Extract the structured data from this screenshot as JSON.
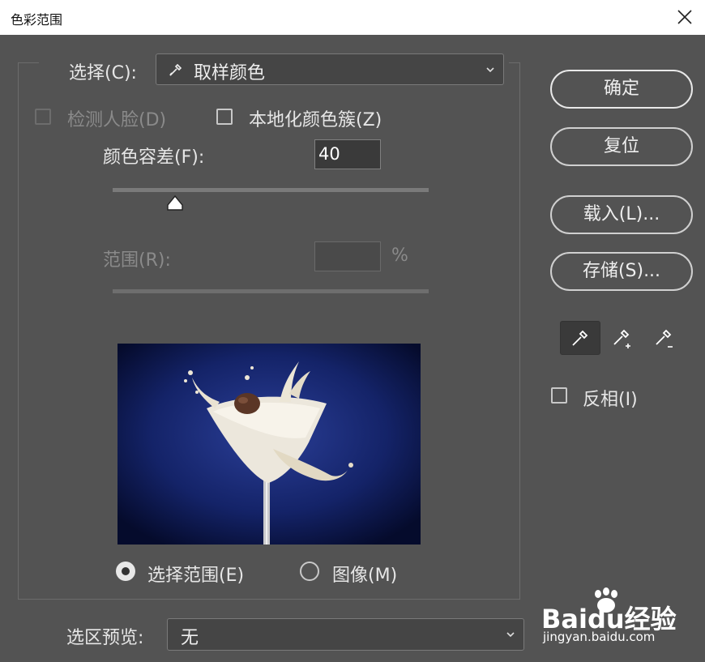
{
  "window": {
    "title": "色彩范围"
  },
  "select": {
    "label": "选择(C):",
    "value": "取样颜色"
  },
  "options": {
    "detect_faces": "检测人脸(D)",
    "localized": "本地化颜色簇(Z)"
  },
  "fuzziness": {
    "label": "颜色容差(F):",
    "value": "40",
    "slider_fraction": 0.2
  },
  "range": {
    "label": "范围(R):",
    "value": "",
    "unit": "%"
  },
  "radio": {
    "selection": "选择范围(E)",
    "image": "图像(M)",
    "selected": "selection"
  },
  "preview_select": {
    "label": "选区预览:",
    "value": "无"
  },
  "buttons": {
    "ok": "确定",
    "reset": "复位",
    "load": "载入(L)...",
    "save": "存储(S)..."
  },
  "tools": [
    "eyedropper-icon",
    "eyedropper-plus-icon",
    "eyedropper-minus-icon"
  ],
  "invert": {
    "label": "反相(I)"
  },
  "watermark": {
    "brand": "Baidu经验",
    "url": "jingyan.baidu.com"
  }
}
